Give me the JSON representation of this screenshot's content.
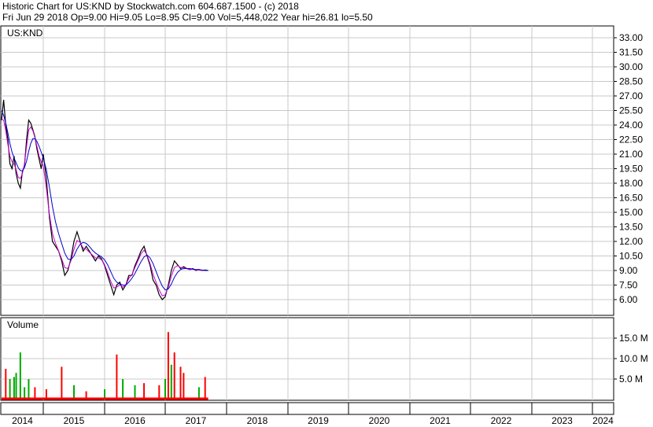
{
  "header": {
    "title_line": "Historic Chart for US:KND by Stockwatch.com 604.687.1500 - (c) 2018",
    "quote_line": "Fri Jun 29 2018   Op=9.00   Hi=9.05   Lo=8.95   Cl=9.00   Vol=5,448,022   Year hi=26.81   lo=5.50"
  },
  "chart_data": [
    {
      "type": "line",
      "title": "US:KND",
      "y_ticks": [
        "33.00",
        "31.50",
        "30.00",
        "28.50",
        "27.00",
        "25.50",
        "24.00",
        "22.50",
        "21.00",
        "19.50",
        "18.00",
        "16.50",
        "15.00",
        "13.50",
        "12.00",
        "10.50",
        "9.00",
        "7.50",
        "6.00"
      ],
      "ylim": [
        4.5,
        34.5
      ],
      "x_ticks": [
        "2014",
        "2015",
        "2016",
        "2017",
        "2018",
        "2019",
        "2020",
        "2021",
        "2022",
        "2023",
        "2024"
      ],
      "grid": true,
      "series": [
        {
          "color": "#000000",
          "points": [
            [
              2014.0,
              24.5
            ],
            [
              2014.05,
              26.6
            ],
            [
              2014.1,
              24.0
            ],
            [
              2014.15,
              22.5
            ],
            [
              2014.2,
              20.0
            ],
            [
              2014.25,
              19.5
            ],
            [
              2014.3,
              20.8
            ],
            [
              2014.35,
              19.0
            ],
            [
              2014.4,
              18.0
            ],
            [
              2014.45,
              17.5
            ],
            [
              2014.5,
              19.2
            ],
            [
              2014.55,
              19.8
            ],
            [
              2014.6,
              22.5
            ],
            [
              2014.65,
              24.5
            ],
            [
              2014.7,
              24.2
            ],
            [
              2014.75,
              23.5
            ],
            [
              2014.8,
              22.8
            ],
            [
              2014.85,
              21.5
            ],
            [
              2014.9,
              20.5
            ],
            [
              2014.95,
              19.5
            ],
            [
              2015.0,
              21.0
            ],
            [
              2015.05,
              18.5
            ],
            [
              2015.1,
              14.5
            ],
            [
              2015.15,
              12.0
            ],
            [
              2015.2,
              11.5
            ],
            [
              2015.25,
              11.0
            ],
            [
              2015.3,
              10.0
            ],
            [
              2015.35,
              8.5
            ],
            [
              2015.4,
              9.0
            ],
            [
              2015.45,
              10.2
            ],
            [
              2015.5,
              12.0
            ],
            [
              2015.55,
              13.0
            ],
            [
              2015.6,
              12.0
            ],
            [
              2015.65,
              11.0
            ],
            [
              2015.7,
              11.5
            ],
            [
              2015.75,
              11.0
            ],
            [
              2015.8,
              10.5
            ],
            [
              2015.85,
              10.0
            ],
            [
              2015.9,
              10.5
            ],
            [
              2015.95,
              10.2
            ],
            [
              2016.0,
              9.5
            ],
            [
              2016.05,
              8.5
            ],
            [
              2016.1,
              7.5
            ],
            [
              2016.15,
              6.5
            ],
            [
              2016.2,
              7.5
            ],
            [
              2016.25,
              7.8
            ],
            [
              2016.3,
              7.0
            ],
            [
              2016.35,
              7.5
            ],
            [
              2016.4,
              8.5
            ],
            [
              2016.45,
              8.5
            ],
            [
              2016.5,
              9.5
            ],
            [
              2016.55,
              10.2
            ],
            [
              2016.6,
              11.0
            ],
            [
              2016.65,
              11.5
            ],
            [
              2016.7,
              10.5
            ],
            [
              2016.75,
              9.5
            ],
            [
              2016.8,
              8.0
            ],
            [
              2016.85,
              7.5
            ],
            [
              2016.9,
              6.5
            ],
            [
              2016.95,
              6.0
            ],
            [
              2017.0,
              6.3
            ],
            [
              2017.05,
              7.5
            ],
            [
              2017.1,
              9.0
            ],
            [
              2017.15,
              10.0
            ],
            [
              2017.2,
              9.6
            ],
            [
              2017.25,
              9.2
            ],
            [
              2017.3,
              9.4
            ],
            [
              2017.35,
              9.2
            ],
            [
              2017.4,
              9.1
            ],
            [
              2017.45,
              9.2
            ],
            [
              2017.5,
              9.0
            ],
            [
              2017.55,
              9.1
            ],
            [
              2017.6,
              9.0
            ],
            [
              2017.65,
              9.05
            ],
            [
              2017.7,
              9.0
            ]
          ]
        },
        {
          "color": "#cc00cc",
          "points": [
            [
              2014.0,
              24.6
            ],
            [
              2014.05,
              24.5
            ],
            [
              2014.1,
              23.4
            ],
            [
              2014.15,
              22.0
            ],
            [
              2014.2,
              20.8
            ],
            [
              2014.25,
              20.2
            ],
            [
              2014.3,
              20.0
            ],
            [
              2014.35,
              19.4
            ],
            [
              2014.4,
              18.6
            ],
            [
              2014.45,
              18.5
            ],
            [
              2014.5,
              19.0
            ],
            [
              2014.55,
              20.0
            ],
            [
              2014.6,
              21.8
            ],
            [
              2014.65,
              23.5
            ],
            [
              2014.7,
              23.8
            ],
            [
              2014.75,
              23.4
            ],
            [
              2014.8,
              22.7
            ],
            [
              2014.85,
              21.8
            ],
            [
              2014.9,
              20.8
            ],
            [
              2014.95,
              20.2
            ],
            [
              2015.0,
              19.8
            ],
            [
              2015.05,
              17.5
            ],
            [
              2015.1,
              14.8
            ],
            [
              2015.15,
              12.8
            ],
            [
              2015.2,
              11.8
            ],
            [
              2015.25,
              11.0
            ],
            [
              2015.3,
              10.2
            ],
            [
              2015.35,
              9.3
            ],
            [
              2015.4,
              9.2
            ],
            [
              2015.45,
              10.0
            ],
            [
              2015.5,
              11.2
            ],
            [
              2015.55,
              12.1
            ],
            [
              2015.6,
              11.9
            ],
            [
              2015.65,
              11.3
            ],
            [
              2015.7,
              11.2
            ],
            [
              2015.75,
              10.9
            ],
            [
              2015.8,
              10.6
            ],
            [
              2015.85,
              10.3
            ],
            [
              2015.9,
              10.3
            ],
            [
              2015.95,
              10.1
            ],
            [
              2016.0,
              9.6
            ],
            [
              2016.05,
              8.8
            ],
            [
              2016.1,
              7.9
            ],
            [
              2016.15,
              7.2
            ],
            [
              2016.2,
              7.3
            ],
            [
              2016.25,
              7.5
            ],
            [
              2016.3,
              7.3
            ],
            [
              2016.35,
              7.5
            ],
            [
              2016.4,
              8.2
            ],
            [
              2016.45,
              8.6
            ],
            [
              2016.5,
              9.3
            ],
            [
              2016.55,
              10.0
            ],
            [
              2016.6,
              10.7
            ],
            [
              2016.65,
              11.1
            ],
            [
              2016.7,
              10.6
            ],
            [
              2016.75,
              9.7
            ],
            [
              2016.8,
              8.6
            ],
            [
              2016.85,
              7.8
            ],
            [
              2016.9,
              7.0
            ],
            [
              2016.95,
              6.4
            ],
            [
              2017.0,
              6.5
            ],
            [
              2017.05,
              7.3
            ],
            [
              2017.1,
              8.4
            ],
            [
              2017.15,
              9.3
            ],
            [
              2017.2,
              9.5
            ],
            [
              2017.25,
              9.3
            ],
            [
              2017.3,
              9.3
            ],
            [
              2017.35,
              9.2
            ],
            [
              2017.4,
              9.1
            ],
            [
              2017.45,
              9.15
            ],
            [
              2017.5,
              9.05
            ],
            [
              2017.55,
              9.05
            ],
            [
              2017.6,
              9.0
            ],
            [
              2017.65,
              9.0
            ],
            [
              2017.7,
              9.0
            ]
          ]
        },
        {
          "color": "#0000cc",
          "points": [
            [
              2014.0,
              25.5
            ],
            [
              2014.05,
              25.0
            ],
            [
              2014.1,
              24.2
            ],
            [
              2014.15,
              23.2
            ],
            [
              2014.2,
              22.1
            ],
            [
              2014.25,
              21.2
            ],
            [
              2014.3,
              20.6
            ],
            [
              2014.35,
              20.1
            ],
            [
              2014.4,
              19.6
            ],
            [
              2014.45,
              19.3
            ],
            [
              2014.5,
              19.3
            ],
            [
              2014.55,
              19.6
            ],
            [
              2014.6,
              20.3
            ],
            [
              2014.65,
              21.3
            ],
            [
              2014.7,
              22.1
            ],
            [
              2014.75,
              22.6
            ],
            [
              2014.8,
              22.6
            ],
            [
              2014.85,
              22.3
            ],
            [
              2014.9,
              21.8
            ],
            [
              2014.95,
              21.2
            ],
            [
              2015.0,
              20.6
            ],
            [
              2015.05,
              19.4
            ],
            [
              2015.1,
              17.6
            ],
            [
              2015.15,
              15.6
            ],
            [
              2015.2,
              14.0
            ],
            [
              2015.25,
              12.8
            ],
            [
              2015.3,
              11.8
            ],
            [
              2015.35,
              10.8
            ],
            [
              2015.4,
              10.2
            ],
            [
              2015.45,
              10.1
            ],
            [
              2015.5,
              10.5
            ],
            [
              2015.55,
              11.2
            ],
            [
              2015.6,
              11.7
            ],
            [
              2015.65,
              11.9
            ],
            [
              2015.7,
              11.8
            ],
            [
              2015.75,
              11.5
            ],
            [
              2015.8,
              11.1
            ],
            [
              2015.85,
              10.8
            ],
            [
              2015.9,
              10.6
            ],
            [
              2015.95,
              10.4
            ],
            [
              2016.0,
              10.1
            ],
            [
              2016.05,
              9.6
            ],
            [
              2016.1,
              8.9
            ],
            [
              2016.15,
              8.2
            ],
            [
              2016.2,
              7.8
            ],
            [
              2016.25,
              7.6
            ],
            [
              2016.3,
              7.5
            ],
            [
              2016.35,
              7.5
            ],
            [
              2016.4,
              7.8
            ],
            [
              2016.45,
              8.2
            ],
            [
              2016.5,
              8.7
            ],
            [
              2016.55,
              9.3
            ],
            [
              2016.6,
              9.9
            ],
            [
              2016.65,
              10.4
            ],
            [
              2016.7,
              10.6
            ],
            [
              2016.75,
              10.3
            ],
            [
              2016.8,
              9.7
            ],
            [
              2016.85,
              8.9
            ],
            [
              2016.9,
              8.1
            ],
            [
              2016.95,
              7.4
            ],
            [
              2017.0,
              7.0
            ],
            [
              2017.05,
              7.1
            ],
            [
              2017.1,
              7.6
            ],
            [
              2017.15,
              8.3
            ],
            [
              2017.2,
              8.8
            ],
            [
              2017.25,
              9.1
            ],
            [
              2017.3,
              9.2
            ],
            [
              2017.35,
              9.2
            ],
            [
              2017.4,
              9.2
            ],
            [
              2017.45,
              9.15
            ],
            [
              2017.5,
              9.1
            ],
            [
              2017.55,
              9.1
            ],
            [
              2017.6,
              9.05
            ],
            [
              2017.65,
              9.0
            ],
            [
              2017.7,
              9.0
            ]
          ]
        }
      ]
    },
    {
      "type": "bar",
      "title": "Volume",
      "y_ticks": [
        "15.0 M",
        "10.0 M",
        "5.0 M"
      ],
      "ylim": [
        0,
        18
      ],
      "x_ticks": [
        "2014",
        "2015",
        "2016",
        "2017",
        "2018",
        "2019",
        "2020",
        "2021",
        "2022",
        "2023",
        "2024"
      ],
      "grid": true,
      "bars": [
        {
          "x": 2014.1,
          "value": 7.5,
          "color": "#ff0000"
        },
        {
          "x": 2014.2,
          "value": 5.0,
          "color": "#00aa00"
        },
        {
          "x": 2014.3,
          "value": 5.5,
          "color": "#00aa00"
        },
        {
          "x": 2014.35,
          "value": 6.5,
          "color": "#00aa00"
        },
        {
          "x": 2014.45,
          "value": 11.5,
          "color": "#00aa00"
        },
        {
          "x": 2014.55,
          "value": 3.0,
          "color": "#00aa00"
        },
        {
          "x": 2014.65,
          "value": 5.0,
          "color": "#00aa00"
        },
        {
          "x": 2014.8,
          "value": 3.0,
          "color": "#ff0000"
        },
        {
          "x": 2015.05,
          "value": 2.5,
          "color": "#ff0000"
        },
        {
          "x": 2015.3,
          "value": 8.0,
          "color": "#ff0000"
        },
        {
          "x": 2015.5,
          "value": 3.5,
          "color": "#00aa00"
        },
        {
          "x": 2015.7,
          "value": 2.0,
          "color": "#ff0000"
        },
        {
          "x": 2016.0,
          "value": 2.5,
          "color": "#00aa00"
        },
        {
          "x": 2016.2,
          "value": 11.0,
          "color": "#ff0000"
        },
        {
          "x": 2016.3,
          "value": 5.0,
          "color": "#00aa00"
        },
        {
          "x": 2016.5,
          "value": 3.5,
          "color": "#00aa00"
        },
        {
          "x": 2016.65,
          "value": 4.0,
          "color": "#ff0000"
        },
        {
          "x": 2016.9,
          "value": 3.5,
          "color": "#ff0000"
        },
        {
          "x": 2017.0,
          "value": 5.0,
          "color": "#00aa00"
        },
        {
          "x": 2017.05,
          "value": 16.5,
          "color": "#ff0000"
        },
        {
          "x": 2017.1,
          "value": 8.5,
          "color": "#00aa00"
        },
        {
          "x": 2017.15,
          "value": 11.5,
          "color": "#ff0000"
        },
        {
          "x": 2017.25,
          "value": 8.0,
          "color": "#ff0000"
        },
        {
          "x": 2017.3,
          "value": 6.5,
          "color": "#ff0000"
        },
        {
          "x": 2017.55,
          "value": 3.0,
          "color": "#00aa00"
        },
        {
          "x": 2017.65,
          "value": 5.5,
          "color": "#ff0000"
        }
      ]
    }
  ]
}
